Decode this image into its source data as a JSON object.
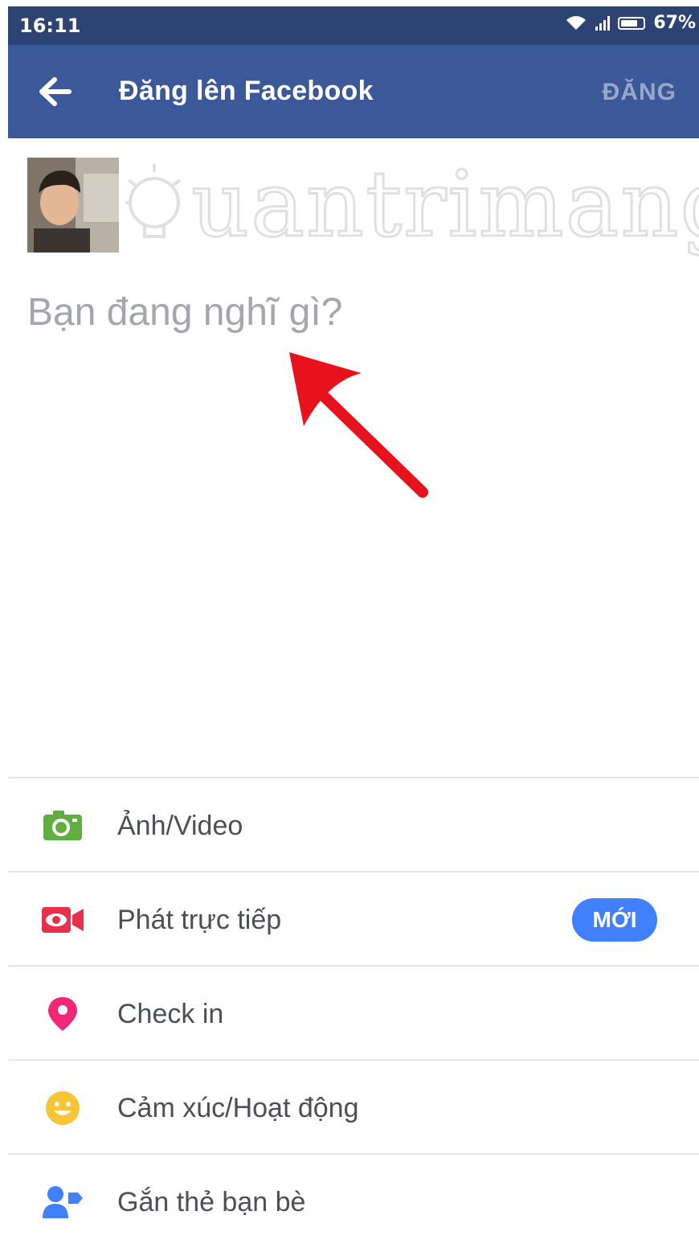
{
  "status_bar": {
    "time": "16:11",
    "battery": "67%",
    "battery_level": 0.67
  },
  "app_bar": {
    "title": "Đăng lên Facebook",
    "post_label": "ĐĂNG"
  },
  "watermark": "uantrimang",
  "composer": {
    "placeholder": "Bạn đang nghĩ gì?",
    "value": ""
  },
  "actions": [
    {
      "label": "Ảnh/Video",
      "icon": "camera-icon",
      "color": "#5fae3f"
    },
    {
      "label": "Phát trực tiếp",
      "icon": "live-video-icon",
      "color": "#e9304a",
      "badge": "MỚI"
    },
    {
      "label": "Check in",
      "icon": "location-pin-icon",
      "color": "#f02877"
    },
    {
      "label": "Cảm xúc/Hoạt động",
      "icon": "smiley-icon",
      "color": "#f7c536"
    },
    {
      "label": "Gắn thẻ bạn bè",
      "icon": "tag-friends-icon",
      "color": "#4080ff"
    }
  ],
  "colors": {
    "header": "#3b5998",
    "status_bar": "#2d4373",
    "badge": "#4080ff",
    "arrow": "#e8121c"
  }
}
